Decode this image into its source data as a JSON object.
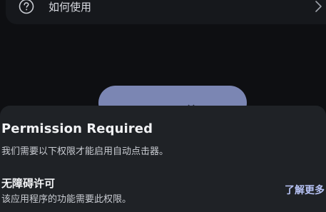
{
  "top_list": {
    "help_item": {
      "label": "如何使用",
      "icon": "help-circle-icon",
      "trailing_icon": "chevron-right-icon"
    }
  },
  "background": {
    "primary_button_color": "#7b86b3"
  },
  "permission_sheet": {
    "title": "Permission Required",
    "description": "我们需要以下权限才能启用自动点击器。",
    "permission": {
      "name": "无障碍许可",
      "description": "该应用程序的功能需要此权限。",
      "action_label": "了解更多"
    },
    "accent_color": "#b7c3f5"
  }
}
